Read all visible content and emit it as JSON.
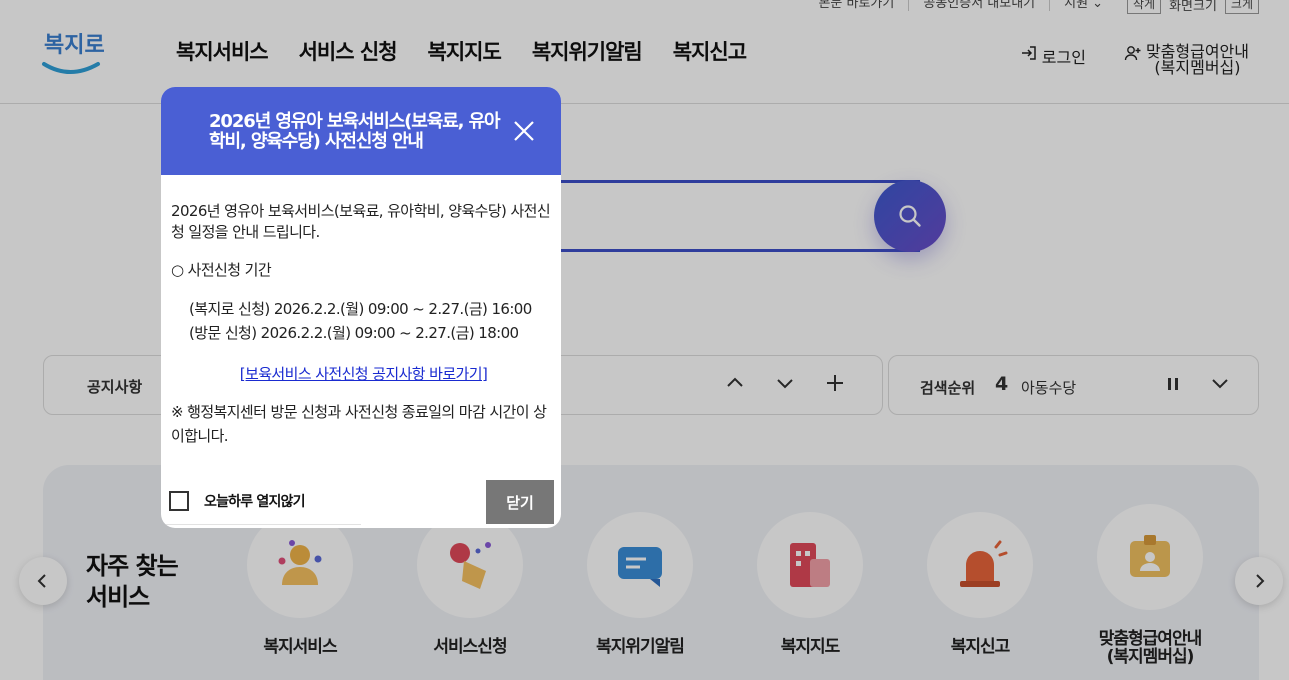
{
  "util": {
    "skip": "본문 바로가기",
    "cert": "공동인증서 내보내기",
    "lang": "지원",
    "zoom_out": "작게",
    "zoom_label": "화면크기",
    "zoom_in": "크게"
  },
  "header": {
    "logo_text": "복지로",
    "nav": [
      "복지서비스",
      "서비스 신청",
      "복지지도",
      "복지위기알림",
      "복지신고"
    ],
    "login": "로그인",
    "membership_line1": "맞춤형급여안내",
    "membership_line2": "(복지멤버십)"
  },
  "notice": {
    "label": "공지사항"
  },
  "rank": {
    "label": "검색순위",
    "number": "4",
    "term": "아동수당"
  },
  "services": {
    "title_line1": "자주 찾는",
    "title_line2": "서비스",
    "items": [
      {
        "name": "복지서비스"
      },
      {
        "name": "서비스신청"
      },
      {
        "name": "복지위기알림"
      },
      {
        "name": "복지지도"
      },
      {
        "name": "복지신고"
      },
      {
        "name": "맞춤형급여안내",
        "name2": "(복지멤버십)"
      }
    ]
  },
  "modal": {
    "title": "2026년 영유아 보육서비스(보육료, 유아학비, 양육수당) 사전신청 안내",
    "intro": "2026년 영유아 보육서비스(보육료, 유아학비, 양육수당) 사전신청 일정을 안내 드립니다.",
    "period_heading": "○ 사전신청 기간",
    "period_online": "(복지로 신청) 2026.2.2.(월) 09:00 ~ 2.27.(금) 16:00",
    "period_visit": "(방문 신청) 2026.2.2.(월) 09:00 ~ 2.27.(금) 18:00",
    "link": "[보육서비스 사전신청 공지사항 바로가기]",
    "note": "※ 행정복지센터 방문 신청과 사전신청 종료일의 마감 시간이 상이합니다.",
    "dont_show": "오늘하루 열지않기",
    "close_button": "닫기"
  },
  "colors": {
    "modal_header": "#4a5fd4",
    "search_accent": "#3d4fc8"
  }
}
